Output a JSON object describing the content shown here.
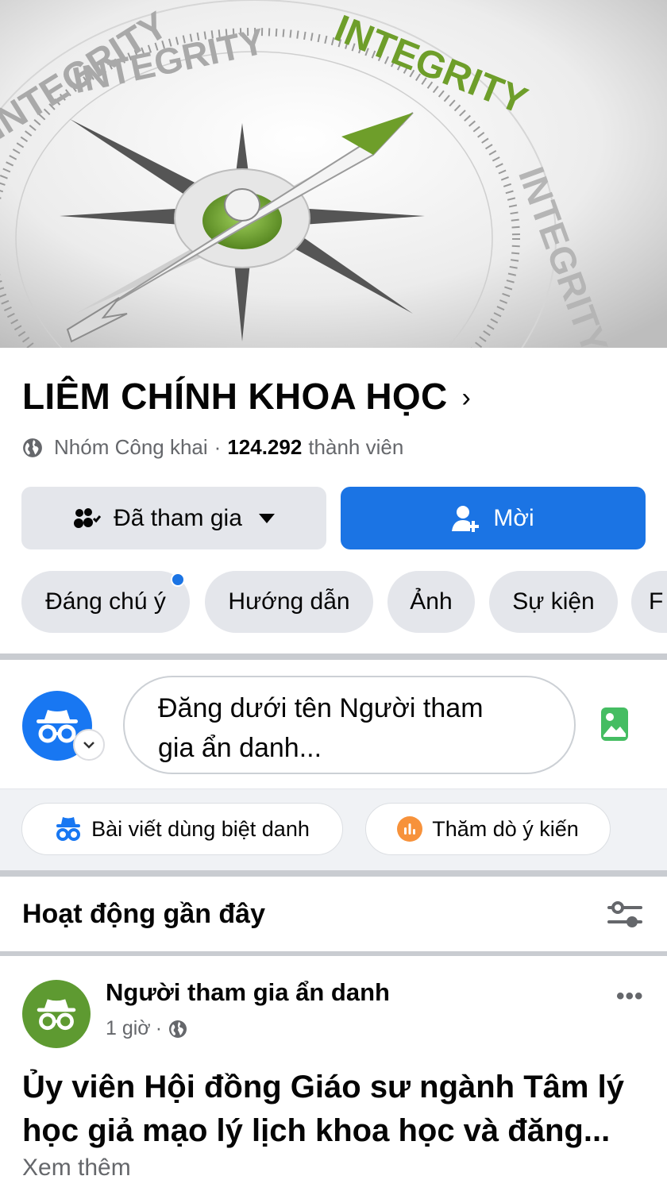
{
  "cover": {
    "words": [
      "INTEGRITY",
      "INTEGRITY",
      "INTEGRITY",
      "INTEGRITY"
    ],
    "accent_color": "#6e9e2a"
  },
  "group": {
    "name": "LIÊM CHÍNH KHOA HỌC",
    "chevron": "›",
    "privacy": "Nhóm Công khai",
    "separator": "·",
    "member_count": "124.292",
    "member_label": "thành viên",
    "globe_icon": "globe-icon"
  },
  "actions": {
    "joined_label": "Đã tham gia",
    "joined_icon": "group-icon",
    "invite_label": "Mời",
    "invite_icon": "add-person-icon",
    "brand_color": "#1b74e4"
  },
  "tabs": [
    {
      "label": "Đáng chú ý",
      "has_dot": true
    },
    {
      "label": "Hướng dẫn"
    },
    {
      "label": "Ảnh"
    },
    {
      "label": "Sự kiện"
    },
    {
      "label": "F"
    }
  ],
  "composer": {
    "placeholder_line1": "Đăng dưới tên Người tham",
    "placeholder_line2": "gia ẩn danh...",
    "avatar_icon": "anonymous-icon",
    "badge_icon": "chevron-down-icon",
    "photo_icon": "photo-icon"
  },
  "post_options": [
    {
      "label": "Bài viết dùng biệt danh",
      "icon": "anonymous-icon"
    },
    {
      "label": "Thăm dò ý kiến",
      "icon": "poll-icon"
    }
  ],
  "activity": {
    "title": "Hoạt động gần đây",
    "filter_icon": "filter-icon"
  },
  "post": {
    "author": "Người tham gia ẩn danh",
    "time": "1 giờ",
    "separator": "·",
    "more": "•••",
    "headline_line1": "Ủy viên Hội đồng Giáo sư ngành Tâm lý",
    "headline_line2": "học giả mạo lý lịch khoa học và đăng...",
    "see_more": "Xem thêm",
    "avatar_color": "#5e9a31"
  }
}
